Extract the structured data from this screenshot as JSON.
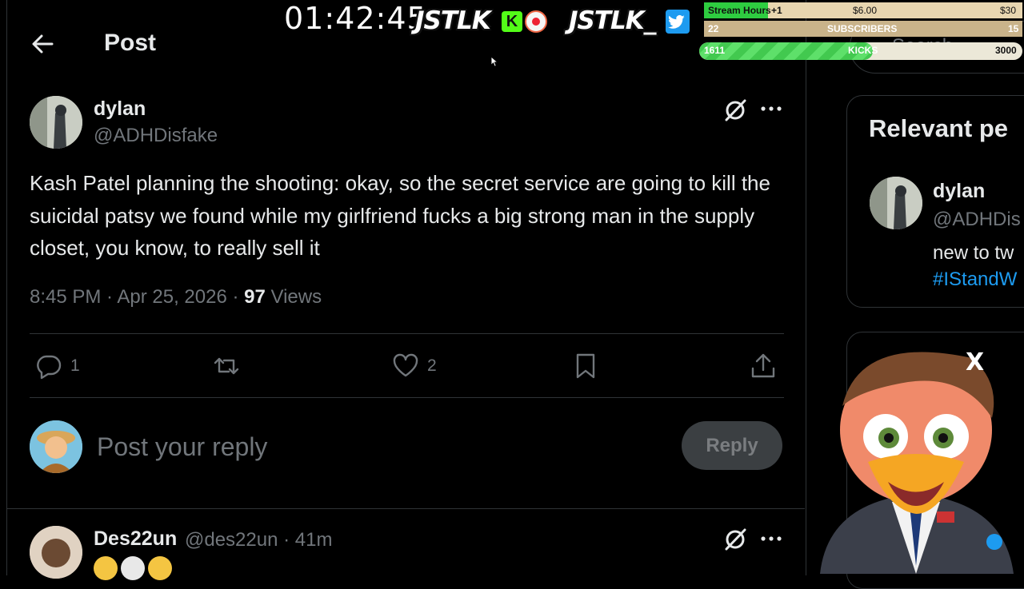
{
  "header": {
    "title": "Post"
  },
  "post": {
    "author_name": "dylan",
    "author_handle": "@ADHDisfake",
    "text": "Kash Patel planning the shooting: okay, so the secret service are going to kill the suicidal patsy we found while my girlfriend fucks a big strong man in the supply closet, you know, to really sell it",
    "timestamp": "8:45 PM · Apr 25, 2026 · ",
    "views_count": "97",
    "views_label": " Views",
    "actions": {
      "reply_count": "1",
      "repost_count": "",
      "like_count": "2"
    }
  },
  "reply_box": {
    "placeholder": "Post your reply",
    "button_label": "Reply"
  },
  "first_reply": {
    "author_name": "Des22un",
    "meta": "@des22un · 41m"
  },
  "sidebar": {
    "search_placeholder": "Search",
    "relevant_title": "Relevant pe",
    "relevant_user": {
      "name": "dylan",
      "handle": "@ADHDis",
      "bio": "new to tw",
      "hashtag": "#IStandW"
    }
  },
  "overlay": {
    "timer": "01:42:45",
    "brand_left": "JSTLK",
    "brand_right": "JSTLK_",
    "kick_glyph": "K",
    "stream_hours_label": "Stream Hours",
    "stream_hours_bonus": "+1",
    "stream_hours_mid": "$6.00",
    "stream_hours_end": "$30",
    "stream_hours_progress": 0.2,
    "subscribers_current": "22",
    "subscribers_label": "SUBSCRIBERS",
    "subscribers_goal": "15",
    "kicks_current": "1611",
    "kicks_label": "KICKS",
    "kicks_goal": "3000",
    "kicks_progress": 0.537,
    "mascot_close": "X"
  },
  "icons": [
    "back-arrow-icon",
    "grok-icon",
    "more-icon",
    "reply-icon",
    "repost-icon",
    "like-icon",
    "bookmark-icon",
    "share-icon",
    "search-icon"
  ],
  "colors": {
    "background": "#000000",
    "text": "#e7e9ea",
    "muted": "#71767b",
    "link": "#1d9bf0",
    "border": "#2f3336"
  }
}
